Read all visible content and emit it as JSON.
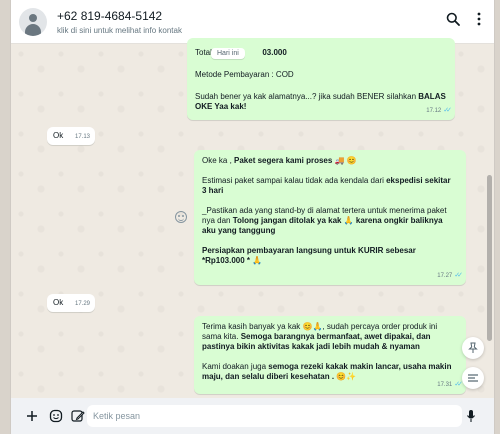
{
  "header": {
    "contact_name": "+62 819-4684-5142",
    "subtitle": "klik di sini untuk melihat info kontak",
    "icons": [
      "search-icon",
      "menu-icon"
    ]
  },
  "date_pill": "Hari ini",
  "messages": {
    "m1": {
      "total_left": "Total Pesa",
      "total_right": "03.000",
      "payment": "Metode Pembayaran : COD",
      "confirm_pre": "Sudah bener ya kak alamatnya...?  jika sudah BENER silahkan ",
      "confirm_bold1": "BALAS",
      "confirm_bold2": "OKE Yaa kak!",
      "time": "17.12"
    },
    "m2": {
      "text": "Ok",
      "time": "17.13"
    },
    "m3": {
      "line1_pre": "Oke ka , ",
      "line1_bold": "Paket segera kami proses",
      "line1_emoji": "🚚 😊",
      "estimasi_pre": "Estimasi paket sampai kalau tidak ada kendala dari ",
      "estimasi_bold": "ekspedisi sekitar",
      "estimasi_bold2": "3 hari",
      "pastikan_pre": "_Pastikan ada yang stand-by di alamat tertera untuk menerima paket nya dan ",
      "pastikan_bold": "Tolong jangan ditolak ya kak",
      "pastikan_emoji": "🙏",
      "pastikan_bold2": "karena ongkir baliknya aku yang tanggung",
      "persiapkan_bold": "Persiapkan pembayaran langsung untuk KURIR sebesar *Rp103.000 *",
      "persiapkan_emoji": "🙏",
      "time": "17.27"
    },
    "m4": {
      "text": "Ok",
      "time": "17.29"
    },
    "m5": {
      "p1_pre": "Terima kasih banyak ya kak ",
      "p1_emoji": "😊🙏",
      "p1_post": ", sudah percaya order produk ini sama kita. ",
      "p1_bold": "Semoga barangnya bermanfaat, awet dipakai, dan pastinya bikin aktivitas kakak jadi lebih mudah & nyaman",
      "p2_pre": " Kami doakan juga ",
      "p2_bold": "semoga rezeki kakak makin lancar, usaha makin maju, dan selalu diberi kesehatan .",
      "p2_emoji": " 😊✨",
      "time": "17.31"
    }
  },
  "footer": {
    "placeholder": "Ketik pesan",
    "icons": [
      "plus-icon",
      "sticker-icon",
      "pencil-icon",
      "mic-icon"
    ]
  },
  "floating": [
    "pin-icon",
    "summary-icon"
  ],
  "colors": {
    "outgoing": "#d9fdd3",
    "incoming": "#ffffff",
    "read_tick": "#53bdeb",
    "background": "#efeae2"
  }
}
